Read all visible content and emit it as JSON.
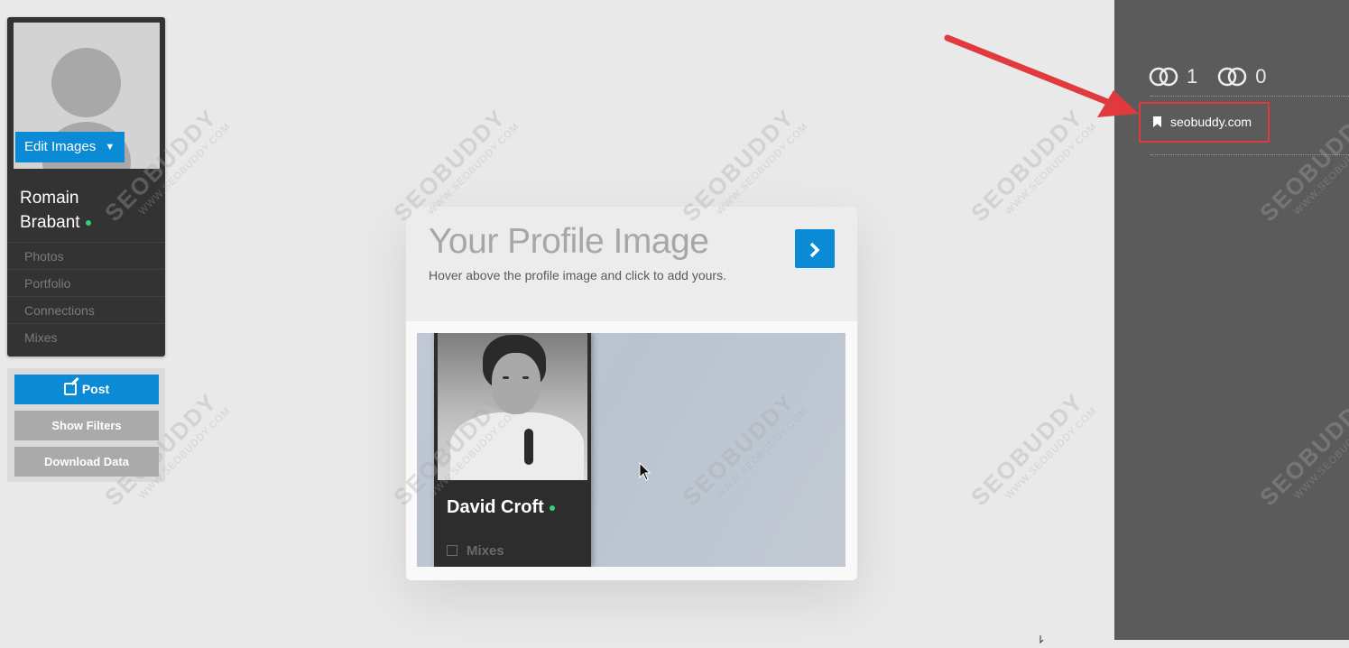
{
  "profile": {
    "edit_images_label": "Edit Images",
    "name_line1": "Romain",
    "name_line2": "Brabant",
    "nav": [
      "Photos",
      "Portfolio",
      "Connections",
      "Mixes"
    ]
  },
  "actions": {
    "post_label": "Post",
    "show_filters_label": "Show Filters",
    "download_data_label": "Download Data"
  },
  "tour": {
    "title": "Your Profile Image",
    "description": "Hover above the profile image and click to add yours.",
    "next_icon": "chevron-right-icon",
    "preview": {
      "name": "David Croft",
      "mixes_label": "Mixes"
    }
  },
  "sidebar": {
    "stat1_value": "1",
    "stat2_value": "0",
    "tag_label": "seobuddy.com"
  },
  "watermark": {
    "brand": "SEOBUDDY",
    "url": "WWW.SEOBUDDY.COM"
  },
  "colors": {
    "accent": "#0b8ad6",
    "online": "#2fd17a",
    "highlight": "#e03a3e"
  }
}
